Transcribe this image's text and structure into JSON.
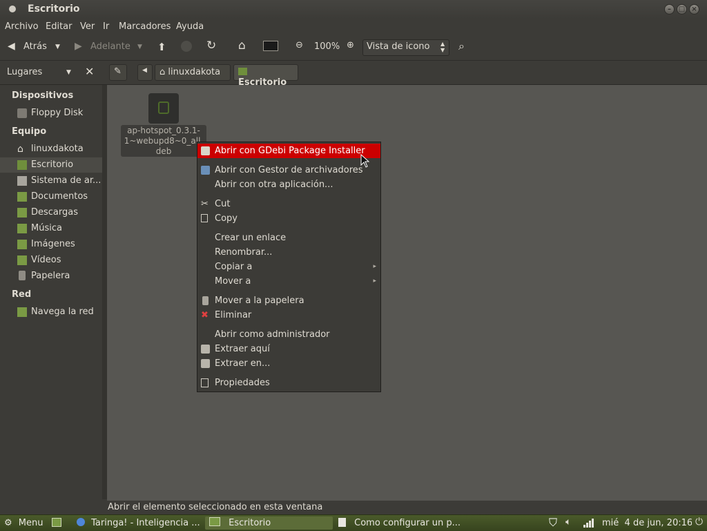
{
  "window": {
    "title": "Escritorio"
  },
  "menubar": [
    "Archivo",
    "Editar",
    "Ver",
    "Ir",
    "Marcadores",
    "Ayuda"
  ],
  "toolbar": {
    "back": "Atrás",
    "forward": "Adelante",
    "zoom": "100%",
    "view_mode": "Vista de icono"
  },
  "places": {
    "label": "Lugares"
  },
  "breadcrumb": [
    "linuxdakota",
    "Escritorio"
  ],
  "sidebar": {
    "devices_title": "Dispositivos",
    "devices": [
      "Floppy Disk"
    ],
    "computer_title": "Equipo",
    "computer": [
      "linuxdakota",
      "Escritorio",
      "Sistema de ar...",
      "Documentos",
      "Descargas",
      "Música",
      "Imágenes",
      "Vídeos",
      "Papelera"
    ],
    "network_title": "Red",
    "network": [
      "Navega la red"
    ]
  },
  "file": {
    "name_line1": "ap-hotspot_0.3.1-",
    "name_line2": "1~webupd8~0_all.",
    "name_line3": "deb"
  },
  "context_menu": [
    "Abrir con GDebi Package Installer",
    "Abrir con Gestor de archivadores",
    "Abrir con otra aplicación...",
    "Cut",
    "Copy",
    "Crear un enlace",
    "Renombrar...",
    "Copiar a",
    "Mover a",
    "Mover a la papelera",
    "Eliminar",
    "Abrir como administrador",
    "Extraer aquí",
    "Extraer en...",
    "Propiedades"
  ],
  "status": "Abrir el elemento seleccionado en esta ventana",
  "panel": {
    "menu": "Menu",
    "tasks": [
      "Taringa! - Inteligencia ...",
      "Escritorio",
      "Como configurar un p..."
    ],
    "clock": "mié  4 de jun, 20:16"
  },
  "colors": {
    "highlight": "#cc0000",
    "panel": "#4a5a2a",
    "background": "#3c3b37"
  }
}
